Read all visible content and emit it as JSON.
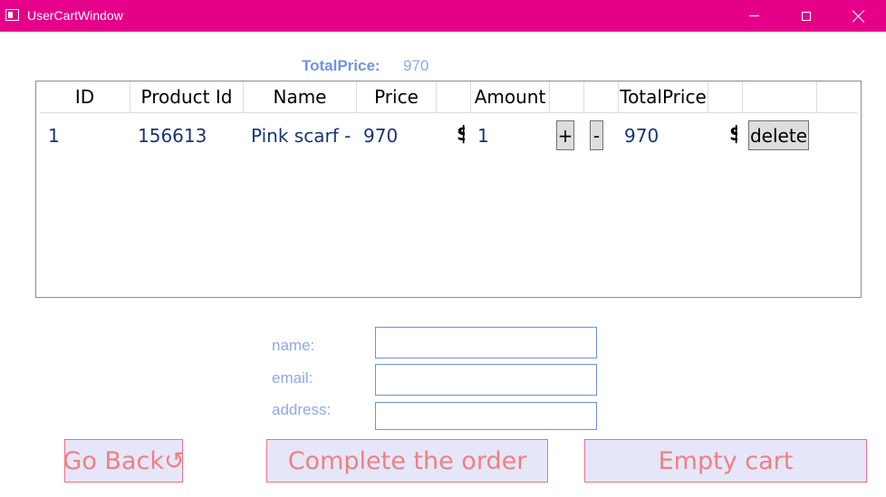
{
  "window": {
    "title": "UserCartWindow"
  },
  "summary": {
    "total_label": "TotalPrice:",
    "total_value": "970"
  },
  "grid": {
    "headers": [
      "ID",
      "Product Id",
      "Name",
      "Price",
      "",
      "Amount",
      "",
      "",
      "TotalPrice",
      "",
      ""
    ],
    "rows": [
      {
        "id": "1",
        "product_id": "156613",
        "name": "Pink scarf - ",
        "price": "970",
        "price_currency": "$",
        "amount": "1",
        "plus_label": "+",
        "minus_label": "-",
        "total": "970",
        "total_currency": "$",
        "delete_label": "delete"
      }
    ]
  },
  "form": {
    "name_label": "name:",
    "email_label": "email:",
    "address_label": "address:",
    "name_value": "",
    "email_value": "",
    "address_value": ""
  },
  "actions": {
    "go_back": "Go Back↺",
    "complete": "Complete the order",
    "empty": "Empty cart"
  },
  "colors": {
    "titlebar": "#e5008a",
    "label_blue": "#6f93e3",
    "button_bg": "#e6e6fa",
    "button_text": "#f08080"
  }
}
